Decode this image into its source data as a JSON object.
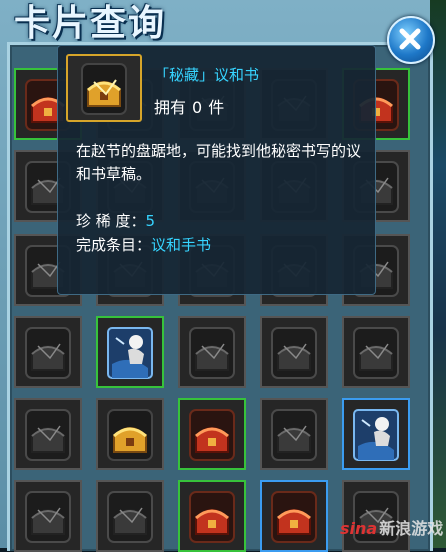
{
  "window": {
    "title": "卡片查询"
  },
  "tooltip": {
    "card_name": "「秘藏」议和书",
    "owned_label": "拥有",
    "owned_count": "0",
    "owned_unit": "件",
    "description": "在赵节的盘踞地，可能找到他秘密书写的议和书草稿。",
    "rarity_label": "珍 稀 度：",
    "rarity_value": "5",
    "condition_label": "完成条目：",
    "condition_value": "议和手书"
  },
  "watermark": {
    "logo": "sina",
    "text": "新浪游戏"
  },
  "colors": {
    "highlight_text": "#36d4ff",
    "green_border": "#37c23b",
    "blue_border": "#3b9cf0",
    "gold_border": "#d6a52a"
  },
  "cards": [
    {
      "row": 0,
      "col": 0,
      "art": "red-chest-icon",
      "border": "green"
    },
    {
      "row": 0,
      "col": 1,
      "art": "locked-card-icon",
      "border": "none"
    },
    {
      "row": 0,
      "col": 2,
      "art": "locked-card-icon",
      "border": "none"
    },
    {
      "row": 0,
      "col": 3,
      "art": "locked-card-icon",
      "border": "none"
    },
    {
      "row": 0,
      "col": 4,
      "art": "red-chest-icon",
      "border": "green"
    },
    {
      "row": 1,
      "col": 0,
      "art": "locked-card-icon",
      "border": "none"
    },
    {
      "row": 1,
      "col": 1,
      "art": "locked-card-icon",
      "border": "none"
    },
    {
      "row": 1,
      "col": 2,
      "art": "locked-card-icon",
      "border": "none"
    },
    {
      "row": 1,
      "col": 3,
      "art": "locked-card-icon",
      "border": "none"
    },
    {
      "row": 1,
      "col": 4,
      "art": "locked-card-icon",
      "border": "none"
    },
    {
      "row": 2,
      "col": 0,
      "art": "locked-card-icon",
      "border": "none"
    },
    {
      "row": 2,
      "col": 1,
      "art": "locked-card-icon",
      "border": "none"
    },
    {
      "row": 2,
      "col": 2,
      "art": "locked-card-icon",
      "border": "none"
    },
    {
      "row": 2,
      "col": 3,
      "art": "locked-card-icon",
      "border": "none"
    },
    {
      "row": 2,
      "col": 4,
      "art": "locked-card-icon",
      "border": "none"
    },
    {
      "row": 3,
      "col": 0,
      "art": "locked-card-icon",
      "border": "none"
    },
    {
      "row": 3,
      "col": 1,
      "art": "character-card-icon",
      "border": "green"
    },
    {
      "row": 3,
      "col": 2,
      "art": "locked-card-icon",
      "border": "none"
    },
    {
      "row": 3,
      "col": 3,
      "art": "locked-card-icon",
      "border": "none"
    },
    {
      "row": 3,
      "col": 4,
      "art": "locked-card-icon",
      "border": "none"
    },
    {
      "row": 4,
      "col": 0,
      "art": "locked-card-icon",
      "border": "none"
    },
    {
      "row": 4,
      "col": 1,
      "art": "gold-chest-icon",
      "border": "none"
    },
    {
      "row": 4,
      "col": 2,
      "art": "red-chest-icon",
      "border": "green"
    },
    {
      "row": 4,
      "col": 3,
      "art": "locked-card-icon",
      "border": "none"
    },
    {
      "row": 4,
      "col": 4,
      "art": "character-card-icon",
      "border": "blue"
    },
    {
      "row": 5,
      "col": 0,
      "art": "locked-card-icon",
      "border": "none"
    },
    {
      "row": 5,
      "col": 1,
      "art": "locked-card-icon",
      "border": "none"
    },
    {
      "row": 5,
      "col": 2,
      "art": "red-chest-icon",
      "border": "green"
    },
    {
      "row": 5,
      "col": 3,
      "art": "red-chest-icon",
      "border": "blue"
    },
    {
      "row": 5,
      "col": 4,
      "art": "locked-card-icon",
      "border": "none"
    }
  ]
}
